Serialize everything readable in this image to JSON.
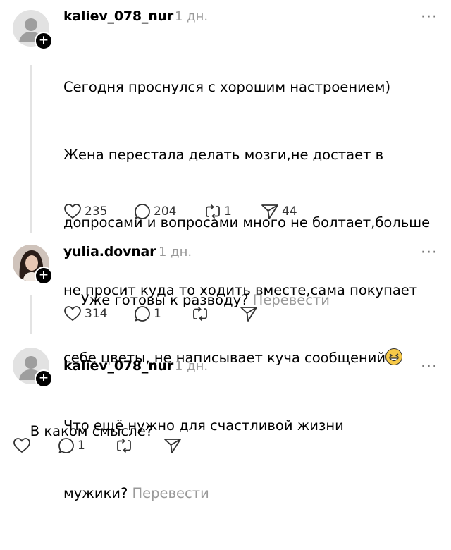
{
  "posts": [
    {
      "username": "kaliev_078_nur",
      "time": "1 дн.",
      "more": "···",
      "lines": [
        "Сегодня проснулся с хорошим настроением)",
        "Жена перестала делать мозги,не достает в",
        "допросами и вопросами много не болтает,больше",
        "не просит куда то ходить вместе,сама покупает",
        "себе цветы, не написывает куча сообщений",
        "Что ещё нужно для счастливой жизни",
        "мужики?"
      ],
      "emoji": "grinning-squinting-face",
      "translate": "Перевести",
      "likes": "235",
      "replies": "204",
      "reposts": "1",
      "shares": "44"
    },
    {
      "username": "yulia.dovnar",
      "time": "1 дн.",
      "more": "···",
      "text": "Уже готовы к разводу?",
      "translate": "Перевести",
      "likes": "314",
      "replies": "1"
    },
    {
      "username": "kaliev_078_nur",
      "time": "1 дн.",
      "more": "···",
      "text": "В каком смысле?",
      "replies": "1"
    }
  ]
}
